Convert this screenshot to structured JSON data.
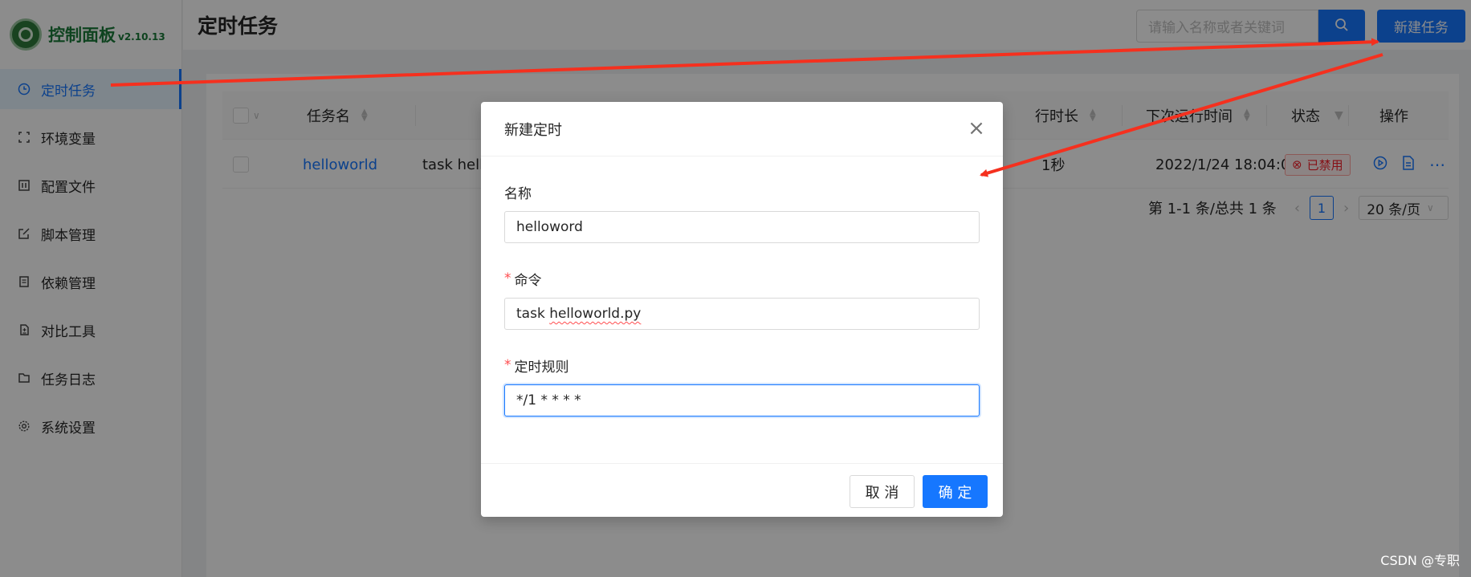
{
  "app": {
    "title": "控制面板",
    "version": "v2.10.13"
  },
  "sidebar": {
    "items": [
      {
        "label": "定时任务",
        "icon": "clock-icon",
        "active": true
      },
      {
        "label": "环境变量",
        "icon": "variable-icon"
      },
      {
        "label": "配置文件",
        "icon": "config-file-icon"
      },
      {
        "label": "脚本管理",
        "icon": "edit-icon"
      },
      {
        "label": "依赖管理",
        "icon": "dependency-icon"
      },
      {
        "label": "对比工具",
        "icon": "diff-icon"
      },
      {
        "label": "任务日志",
        "icon": "folder-icon"
      },
      {
        "label": "系统设置",
        "icon": "gear-icon"
      }
    ]
  },
  "header": {
    "title": "定时任务",
    "search_placeholder": "请输入名称或者关键词",
    "new_button": "新建任务"
  },
  "table": {
    "columns": [
      "任务名",
      "行时长",
      "下次运行时间",
      "状态",
      "操作"
    ],
    "rows": [
      {
        "name": "helloworld",
        "command": "task hello",
        "duration": "1秒",
        "next_run": "2022/1/24 18:04:00",
        "status": "已禁用"
      }
    ]
  },
  "pagination": {
    "summary": "第 1-1 条/总共 1 条",
    "current_page": "1",
    "page_size": "20 条/页"
  },
  "modal": {
    "title": "新建定时",
    "fields": {
      "name_label": "名称",
      "name_value": "helloword",
      "command_label": "命令",
      "command_prefix": "task ",
      "command_file": "helloworld.py",
      "schedule_label": "定时规则",
      "schedule_value": "*/1 * * * *"
    },
    "cancel_button": "取 消",
    "ok_button": "确 定"
  },
  "watermark": "CSDN @专职",
  "colors": {
    "primary": "#1677ff",
    "brand_green": "#1b7a3a",
    "danger": "#f5222d",
    "annotation_arrow": "#f5301e"
  }
}
